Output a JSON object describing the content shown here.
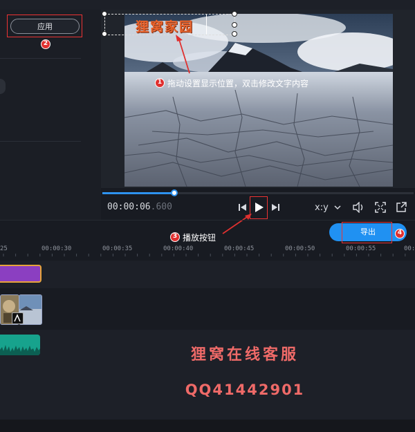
{
  "sidebar": {
    "apply_label": "应用"
  },
  "preview": {
    "title_text": "狸窝家园",
    "annotation_1": "拖动设置显示位置，双击修改文字内容"
  },
  "player": {
    "timecode_main": "00:00:06",
    "timecode_frac": ".600",
    "aspect_label": "x:y",
    "progress": 0.23
  },
  "annotations": {
    "badge_1": "1",
    "badge_2": "2",
    "badge_3": "3",
    "badge_4": "4",
    "play_label": "播放按钮"
  },
  "toolbar": {
    "export_label": "导出"
  },
  "timeline": {
    "ticks": [
      "25",
      "00:00:30",
      "00:00:35",
      "00:00:40",
      "00:00:45",
      "00:00:50",
      "00:00:55",
      "00:0"
    ]
  },
  "watermark": {
    "line1": "狸窝在线客服",
    "line2": "QQ41442901"
  },
  "colors": {
    "accent": "#2091f2",
    "annotation_red": "#e0302f",
    "clip_purple": "#8b3fc1",
    "clip_audio": "#17a38d",
    "watermark": "#ef6a68",
    "title_orange": "#e8632c"
  }
}
